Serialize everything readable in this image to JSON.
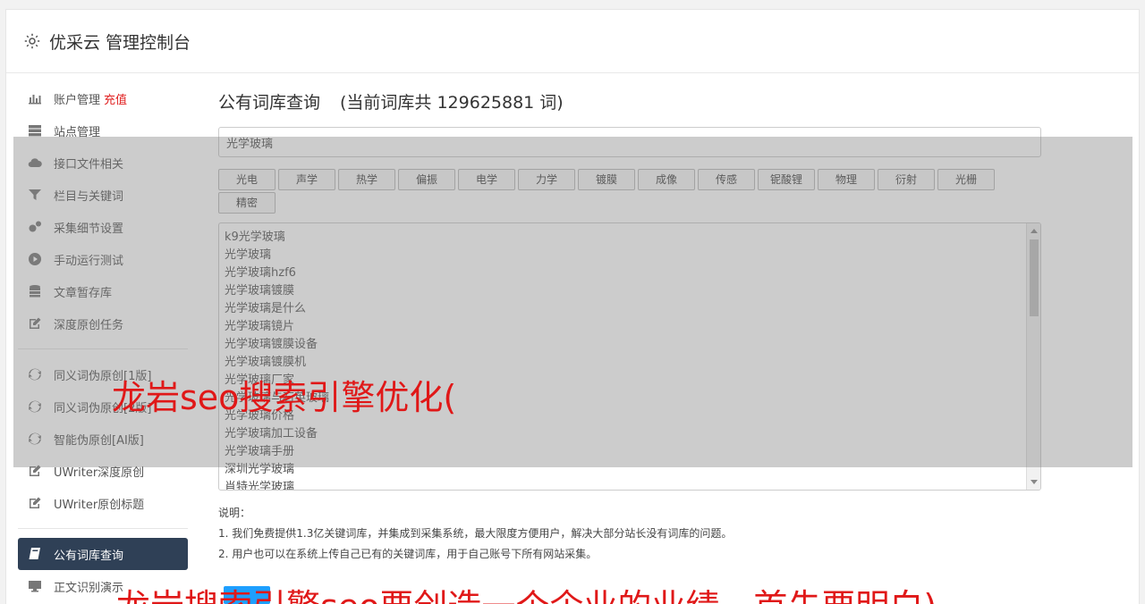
{
  "app": {
    "title": "优采云 管理控制台"
  },
  "sidebar": {
    "items": [
      {
        "label": "账户管理",
        "extra": "充值",
        "icon": "bar-chart-icon"
      },
      {
        "label": "站点管理",
        "icon": "server-icon"
      },
      {
        "label": "接口文件相关",
        "icon": "cloud-upload-icon"
      },
      {
        "label": "栏目与关键词",
        "icon": "filter-icon"
      },
      {
        "label": "采集细节设置",
        "icon": "gears-icon"
      },
      {
        "label": "手动运行测试",
        "icon": "play-circle-icon"
      },
      {
        "label": "文章暂存库",
        "icon": "database-icon"
      },
      {
        "label": "深度原创任务",
        "icon": "edit-icon"
      }
    ],
    "items2": [
      {
        "label": "同义词伪原创[1版]",
        "icon": "refresh-icon"
      },
      {
        "label": "同义词伪原创[2版]",
        "icon": "refresh-icon"
      },
      {
        "label": "智能伪原创[AI版]",
        "icon": "refresh-icon"
      },
      {
        "label": "UWriter深度原创",
        "icon": "edit-icon"
      },
      {
        "label": "UWriter原创标题",
        "icon": "edit-icon"
      }
    ],
    "items3": [
      {
        "label": "公有词库查询",
        "icon": "book-icon",
        "active": true
      },
      {
        "label": "正文识别演示",
        "icon": "desktop-icon"
      }
    ]
  },
  "main": {
    "title": "公有词库查询",
    "count_text": "(当前词库共 129625881 词)",
    "search_value": "光学玻璃",
    "tags": [
      "光电",
      "声学",
      "热学",
      "偏振",
      "电学",
      "力学",
      "镀膜",
      "成像",
      "传感",
      "铌酸锂",
      "物理",
      "衍射",
      "光栅",
      "精密"
    ],
    "results": [
      "k9光学玻璃",
      "光学玻璃",
      "光学玻璃hzf6",
      "光学玻璃镀膜",
      "光学玻璃是什么",
      "光学玻璃镜片",
      "光学玻璃镀膜设备",
      "光学玻璃镀膜机",
      "光学玻璃厂家",
      "光学玻璃与石英玻璃",
      "光学玻璃价格",
      "光学玻璃加工设备",
      "光学玻璃手册",
      "深圳光学玻璃",
      "肖特光学玻璃"
    ],
    "notes": {
      "heading": "说明：",
      "line1": "1. 我们免费提供1.3亿关键词库，并集成到采集系统，最大限度方便用户，解决大部分站长没有词库的问题。",
      "line2": "2. 用户也可以在系统上传自己已有的关键词库，用于自己账号下所有网站采集。"
    }
  },
  "watermarks": {
    "wm1": "龙岩seo搜索引擎优化(",
    "wm2": "龙岩搜索引擎seo要创造一个企业的业绩，首先要明白)"
  },
  "colors": {
    "active_bg": "#2f4056",
    "accent_red": "#e02020",
    "watermark_red": "#e01818"
  }
}
